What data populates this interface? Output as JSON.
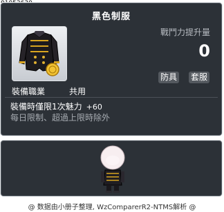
{
  "item": {
    "id": "01052630",
    "name": "黑色制服",
    "upgrade_label": "戰鬥力提升量",
    "upgrade_value": "0",
    "tags": [
      "防具",
      "套服"
    ],
    "job_label": "裝備職業",
    "job_value": "共用",
    "effect_text": "裝備時僅限1次魅力",
    "effect_bonus": "+60",
    "limit_text": "每日限制、超過上限時除外"
  },
  "footer": {
    "credit": "@ 数据由小册子整理, WzComparerR2-NTMS解析 @"
  },
  "colors": {
    "panel_bg": "#2c3137",
    "tag_bg": "#54595f",
    "muted_text": "#a7acb2"
  }
}
